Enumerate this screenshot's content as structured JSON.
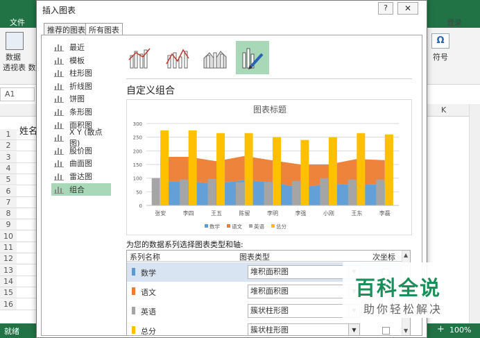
{
  "excel": {
    "file_tab": "文件",
    "login": "登录",
    "ribbon_btn_line1": "数据",
    "ribbon_btn_line2": "透视表 数",
    "symbol_label": "符号",
    "symbol_glyph": "Ω",
    "name_box": "A1",
    "col_k": "K",
    "cell_a1": "姓名",
    "rows": [
      "1",
      "2",
      "3",
      "4",
      "5",
      "6",
      "7",
      "8",
      "9",
      "10",
      "11",
      "12",
      "13",
      "14",
      "15",
      "16"
    ],
    "status": "就绪",
    "zoom": "100%",
    "zoom_plus": "+"
  },
  "dialog": {
    "title": "插入图表",
    "help": "?",
    "close": "✕",
    "tabs": [
      "推荐的图表",
      "所有图表"
    ],
    "active_tab": 1,
    "chart_types": [
      {
        "label": "最近",
        "icon": "undo-icon"
      },
      {
        "label": "模板",
        "icon": "folder-icon"
      },
      {
        "label": "柱形图",
        "icon": "column-chart-icon"
      },
      {
        "label": "折线图",
        "icon": "line-chart-icon"
      },
      {
        "label": "饼图",
        "icon": "pie-chart-icon"
      },
      {
        "label": "条形图",
        "icon": "bar-chart-icon"
      },
      {
        "label": "面积图",
        "icon": "area-chart-icon"
      },
      {
        "label": "X Y (散点图)",
        "icon": "scatter-chart-icon"
      },
      {
        "label": "股价图",
        "icon": "stock-chart-icon"
      },
      {
        "label": "曲面图",
        "icon": "surface-chart-icon"
      },
      {
        "label": "雷达图",
        "icon": "radar-chart-icon"
      },
      {
        "label": "组合",
        "icon": "combo-chart-icon"
      }
    ],
    "selected_type": 11,
    "subtypes": [
      "clustered-column-line-icon",
      "clustered-column-line-secondary-icon",
      "stacked-area-column-icon",
      "custom-combo-icon"
    ],
    "selected_subtype": 3,
    "heading": "自定义组合",
    "series_prompt": "为您的数据系列选择图表类型和轴:",
    "table_headers": {
      "name": "系列名称",
      "type": "图表类型",
      "secondary": "次坐标轴"
    },
    "series_rows": [
      {
        "name": "数学",
        "type": "堆积面积图",
        "color": "#5b9bd5"
      },
      {
        "name": "语文",
        "type": "堆积面积图",
        "color": "#ed7d31"
      },
      {
        "name": "英语",
        "type": "簇状柱形图",
        "color": "#a5a5a5"
      },
      {
        "name": "总分",
        "type": "簇状柱形图",
        "color": "#ffc000"
      }
    ],
    "selected_row": 0
  },
  "chart_data": {
    "type": "combo",
    "title": "图表标题",
    "categories": [
      "张安",
      "李四",
      "王五",
      "陈留",
      "李明",
      "李强",
      "小刚",
      "王东",
      "李磊"
    ],
    "ylim": [
      0,
      300
    ],
    "yticks": [
      0,
      50,
      100,
      150,
      200,
      250,
      300
    ],
    "grid": true,
    "legend_position": "bottom",
    "series": [
      {
        "name": "数学",
        "chart": "stacked-area",
        "color": "#5b9bd5",
        "values": [
          88,
          88,
          80,
          93,
          85,
          65,
          80,
          75,
          78
        ]
      },
      {
        "name": "语文",
        "chart": "stacked-area",
        "color": "#ed7d31",
        "values": [
          90,
          90,
          82,
          88,
          80,
          85,
          70,
          95,
          88
        ]
      },
      {
        "name": "英语",
        "chart": "clustered-column",
        "color": "#a5a5a5",
        "values": [
          100,
          95,
          98,
          85,
          85,
          90,
          100,
          95,
          95
        ]
      },
      {
        "name": "总分",
        "chart": "clustered-column",
        "color": "#ffc000",
        "values": [
          275,
          275,
          265,
          265,
          250,
          240,
          250,
          265,
          260
        ]
      }
    ]
  },
  "watermark": {
    "logo": "百科全说",
    "sub": "助你轻松解决"
  }
}
